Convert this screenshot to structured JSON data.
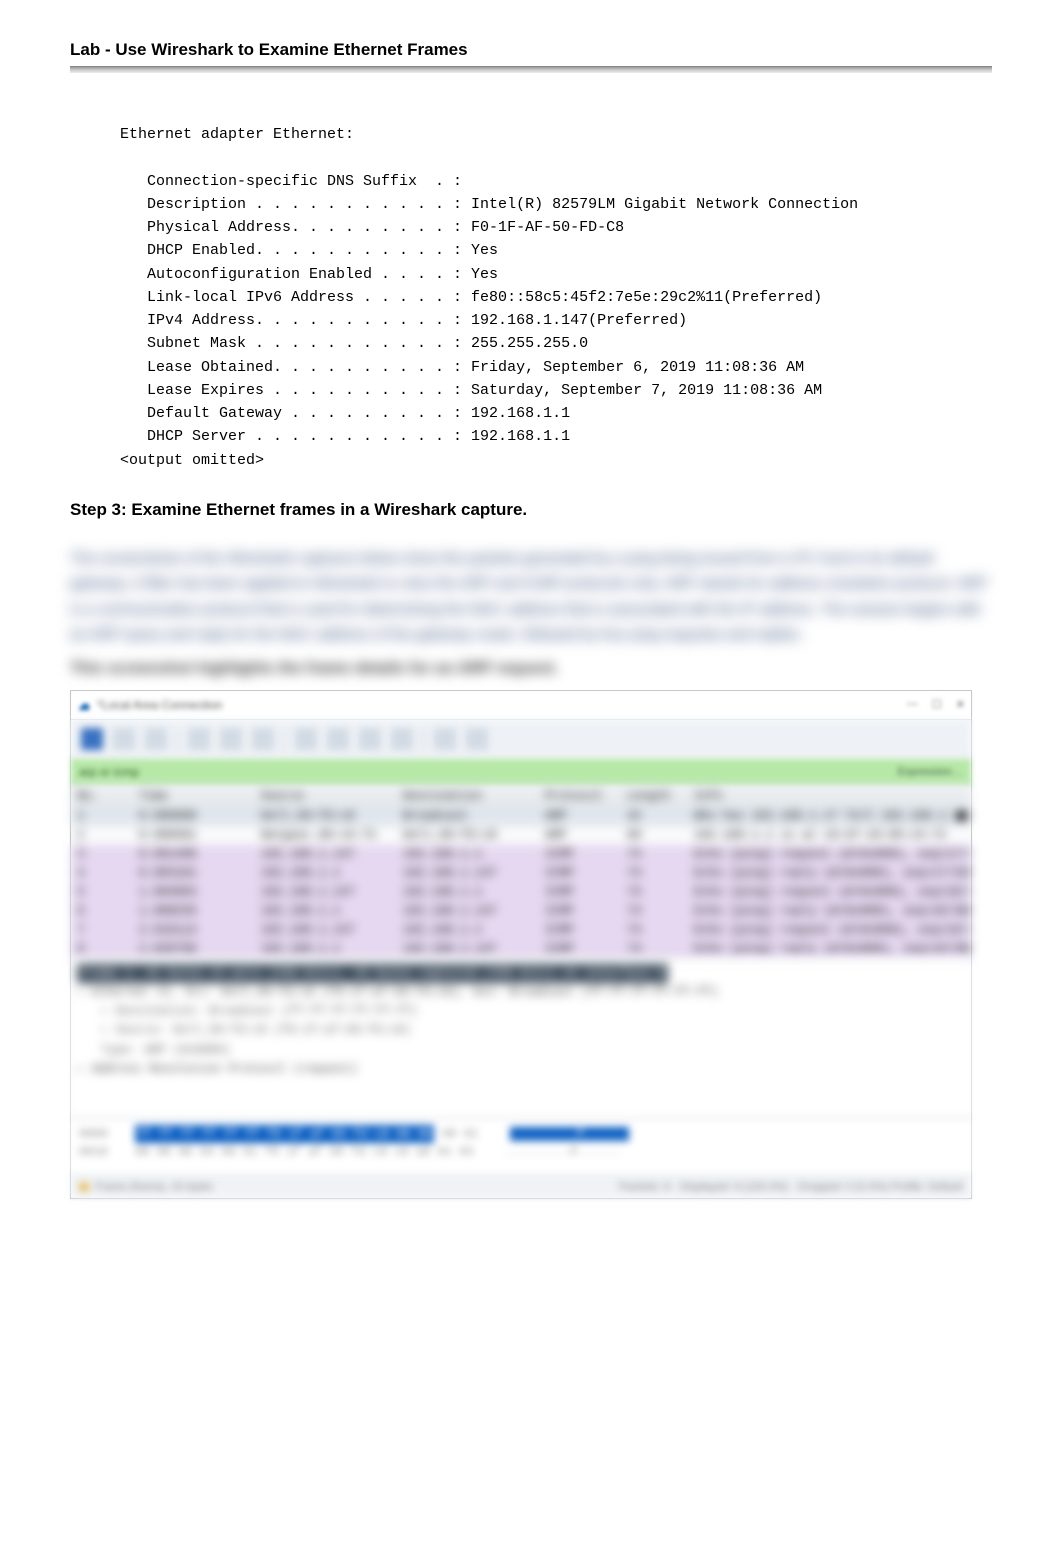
{
  "header": {
    "title": "Lab - Use Wireshark to Examine Ethernet Frames"
  },
  "console": {
    "adapter_title": "Ethernet adapter Ethernet:",
    "lines": [
      "   Connection-specific DNS Suffix  . :",
      "   Description . . . . . . . . . . . : Intel(R) 82579LM Gigabit Network Connection",
      "   Physical Address. . . . . . . . . : F0-1F-AF-50-FD-C8",
      "   DHCP Enabled. . . . . . . . . . . : Yes",
      "   Autoconfiguration Enabled . . . . : Yes",
      "   Link-local IPv6 Address . . . . . : fe80::58c5:45f2:7e5e:29c2%11(Preferred)",
      "   IPv4 Address. . . . . . . . . . . : 192.168.1.147(Preferred)",
      "   Subnet Mask . . . . . . . . . . . : 255.255.255.0",
      "   Lease Obtained. . . . . . . . . . : Friday, September 6, 2019 11:08:36 AM",
      "   Lease Expires . . . . . . . . . . : Saturday, September 7, 2019 11:08:36 AM",
      "   Default Gateway . . . . . . . . . : 192.168.1.1",
      "   DHCP Server . . . . . . . . . . . : 192.168.1.1"
    ],
    "omitted": "<output omitted>"
  },
  "step": {
    "heading": "Step 3: Examine Ethernet frames in a Wireshark capture."
  },
  "blurred": {
    "para": "The screenshots of the Wireshark captures below show the packets generated by a ping being issued from a PC host to its default gateway. A filter has been applied to Wireshark to view the ARP and ICMP protocols only. ARP stands for address resolution protocol. ARP is a communication protocol that is used for determining the MAC address that is associated with the IP address. The session begins with an ARP query and reply for the MAC address of the gateway router, followed by four ping requests and replies.",
    "line2": "This screenshot highlights the frame details for an ARP request."
  },
  "wireshark": {
    "window_title": "*Local Area Connection",
    "win_controls": {
      "min": "—",
      "max": "☐",
      "close": "✕"
    },
    "filter_text": "arp or icmp",
    "filter_hint": "Expression…",
    "columns": [
      "No.",
      "Time",
      "Source",
      "Destination",
      "Protocol",
      "Length",
      "Info"
    ],
    "rows": [
      {
        "no": "1",
        "time": "0.000000",
        "src": "Dell_50:fd:c8",
        "dst": "Broadcast",
        "proto": "ARP",
        "len": "42",
        "info": "Who has 192.168.1.1? Tell 192.168.1.147",
        "cls": "sel"
      },
      {
        "no": "2",
        "time": "0.000581",
        "src": "Netgear_99:c5:72",
        "dst": "Dell_50:fd:c8",
        "proto": "ARP",
        "len": "60",
        "info": "192.168.1.1 is at c8:d7:19:99:c5:72",
        "cls": ""
      },
      {
        "no": "3",
        "time": "0.001408",
        "src": "192.168.1.147",
        "dst": "192.168.1.1",
        "proto": "ICMP",
        "len": "74",
        "info": "Echo (ping) request  id=0x0001, seq=17/4352, ttl=128",
        "cls": "purple"
      },
      {
        "no": "4",
        "time": "0.003101",
        "src": "192.168.1.1",
        "dst": "192.168.1.147",
        "proto": "ICMP",
        "len": "74",
        "info": "Echo (ping) reply    id=0x0001, seq=17/4352, ttl=64",
        "cls": "purple"
      },
      {
        "no": "5",
        "time": "1.004894",
        "src": "192.168.1.147",
        "dst": "192.168.1.1",
        "proto": "ICMP",
        "len": "74",
        "info": "Echo (ping) request  id=0x0001, seq=18/4608, ttl=128",
        "cls": "purple"
      },
      {
        "no": "6",
        "time": "1.006535",
        "src": "192.168.1.1",
        "dst": "192.168.1.147",
        "proto": "ICMP",
        "len": "74",
        "info": "Echo (ping) reply    id=0x0001, seq=18/4608, ttl=64",
        "cls": "purple"
      },
      {
        "no": "7",
        "time": "2.019114",
        "src": "192.168.1.147",
        "dst": "192.168.1.1",
        "proto": "ICMP",
        "len": "74",
        "info": "Echo (ping) request  id=0x0001, seq=19/4864, ttl=128",
        "cls": "purple"
      },
      {
        "no": "8",
        "time": "2.020796",
        "src": "192.168.1.1",
        "dst": "192.168.1.147",
        "proto": "ICMP",
        "len": "74",
        "info": "Echo (ping) reply    id=0x0001, seq=19/4864, ttl=64",
        "cls": "purple"
      }
    ],
    "details": [
      {
        "txt": "Frame 1: 42 bytes on wire (336 bits), 42 bytes captured (336 bits) on interface 0",
        "cls": "hl"
      },
      {
        "txt": "Ethernet II, Src: Dell_50:fd:c8 (f0:1f:af:50:fd:c8), Dst: Broadcast (ff:ff:ff:ff:ff:ff)",
        "cls": "arrow"
      },
      {
        "txt": "Destination: Broadcast (ff:ff:ff:ff:ff:ff)",
        "cls": "sub arrow"
      },
      {
        "txt": "Source: Dell_50:fd:c8 (f0:1f:af:50:fd:c8)",
        "cls": "sub arrow"
      },
      {
        "txt": "Type: ARP (0x0806)",
        "cls": "sub"
      },
      {
        "txt": "Address Resolution Protocol (request)",
        "cls": "arrow"
      }
    ],
    "hex": [
      {
        "offset": "0000",
        "sel": "ff ff ff ff ff ff f0 1f  af 50 fd c8 08 06",
        "rest": "00 01",
        "ascii_sel": ".........P......",
        "ascii_rest": ""
      },
      {
        "offset": "0010",
        "sel": "",
        "rest": "08 00 06 04 00 01 f0 1f  af 50 fd c8 c0 a8 01 93",
        "ascii_sel": "",
        "ascii_rest": ".........P......"
      }
    ],
    "status_left": "Frame (frame), 42 bytes",
    "status_right": "Packets: 8 · Displayed: 8 (100.0%) · Dropped: 0 (0.0%)   Profile: Default"
  }
}
